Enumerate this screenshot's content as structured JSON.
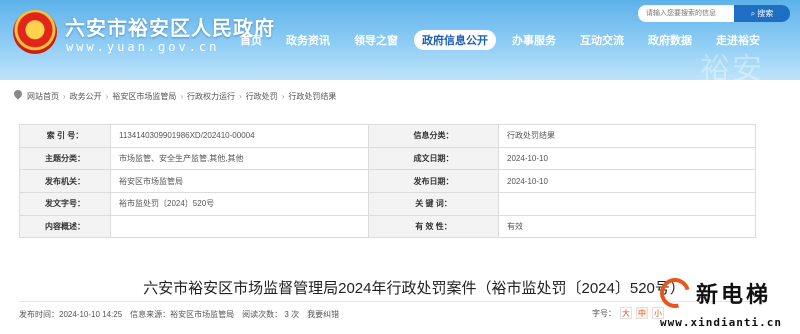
{
  "header": {
    "title": "六安市裕安区人民政府",
    "url": "www.yuan.gov.cn",
    "bg_text": "裕安",
    "search": {
      "placeholder": "请输入您要搜索的信息",
      "button": "搜索",
      "icon": "search-icon"
    },
    "nav": [
      {
        "label": "首页",
        "active": false
      },
      {
        "label": "政务资讯",
        "active": false
      },
      {
        "label": "领导之窗",
        "active": false
      },
      {
        "label": "政府信息公开",
        "active": true
      },
      {
        "label": "办事服务",
        "active": false
      },
      {
        "label": "互动交流",
        "active": false
      },
      {
        "label": "政府数据",
        "active": false
      },
      {
        "label": "走进裕安",
        "active": false
      }
    ],
    "colors": {
      "gradient_top": "#5db2ea",
      "gradient_bottom": "#bfe4fb",
      "active_nav_text": "#1b5fb8"
    }
  },
  "breadcrumb": [
    "网站首页",
    "政务公开",
    "裕安区市场监管局",
    "行政权力运行",
    "行政处罚",
    "行政处罚结果"
  ],
  "info": {
    "rows": [
      {
        "l1": "索 引 号：",
        "v1": "1134140309901986XD/202410-00004",
        "l2": "信息分类：",
        "v2": "行政处罚结果"
      },
      {
        "l1": "主题分类：",
        "v1": "市场监管、安全生产监管,其他,其他",
        "l2": "成文日期：",
        "v2": "2024-10-10"
      },
      {
        "l1": "发布机关：",
        "v1": "裕安区市场监管局",
        "l2": "发布日期：",
        "v2": "2024-10-10"
      },
      {
        "l1": "发文字号：",
        "v1": "裕市监处罚〔2024〕520号",
        "l2": "关 键 词：",
        "v2": ""
      },
      {
        "l1": "内容概述：",
        "v1": "",
        "l2": "有 效 性：",
        "v2": "有效"
      }
    ]
  },
  "doc": {
    "title": "六安市裕安区市场监督管理局2024年行政处罚案件（裕市监处罚〔2024〕520号）",
    "meta": {
      "publish_time": "发布时间：2024-10-10 14:25",
      "source": "信息来源：裕安区市场监管局",
      "views_label": "阅读次数：",
      "views": "3",
      "views_unit": "次",
      "correction": "我要纠错"
    },
    "font_size": {
      "label": "字号：",
      "options": [
        "大",
        "中",
        "小"
      ],
      "selected": "中"
    }
  },
  "watermark": {
    "text": "新电梯",
    "url": "www.xindianti.cn"
  }
}
